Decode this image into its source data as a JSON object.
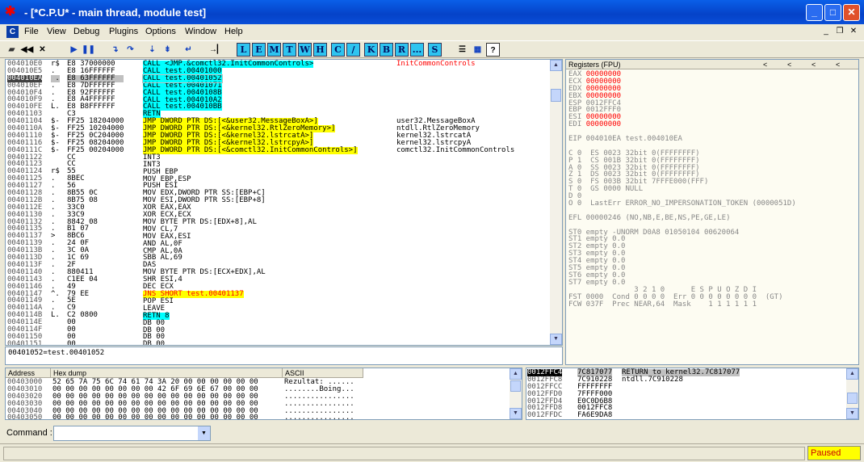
{
  "window": {
    "title": "- [*C.P.U* - main thread, module test]",
    "icon": "bug-icon",
    "controls": [
      "_",
      "□",
      "✕"
    ]
  },
  "menu": {
    "icon_letter": "C",
    "items": [
      "File",
      "View",
      "Debug",
      "Plugins",
      "Options",
      "Window",
      "Help"
    ]
  },
  "toolbar": {
    "letters": [
      "L",
      "E",
      "M",
      "T",
      "W",
      "H",
      "C",
      "/",
      "K",
      "B",
      "R",
      "...",
      "S"
    ]
  },
  "disasm": {
    "addresses": [
      "004010E0",
      "004010E5",
      "004010EA",
      "004010EF",
      "004010F4",
      "004010F9",
      "004010FE",
      "00401103",
      "00401104",
      "0040110A",
      "00401110",
      "00401116",
      "0040111C",
      "00401122",
      "00401123",
      "00401124",
      "00401125",
      "00401127",
      "00401128",
      "0040112B",
      "0040112E",
      "00401130",
      "00401132",
      "00401135",
      "00401137",
      "00401139",
      "0040113B",
      "0040113D",
      "0040113F",
      "00401140",
      "00401143",
      "00401146",
      "00401147",
      "00401149",
      "0040114A",
      "0040114B",
      "0040114E",
      "0040114F",
      "00401150",
      "00401151"
    ],
    "marks": [
      "r$",
      ".",
      " .",
      ". ",
      ". ",
      ". ",
      "L.",
      "  ",
      "$-",
      "$-",
      "$-",
      "$-",
      "$-",
      "  ",
      "  ",
      "r$",
      ". ",
      ". ",
      ". ",
      ". ",
      ". ",
      ". ",
      ". ",
      ". ",
      "> ",
      ". ",
      ". ",
      ". ",
      ". ",
      ". ",
      ". ",
      ". ",
      "^.",
      ". ",
      ". ",
      "L.",
      "  ",
      "  ",
      "  ",
      "  "
    ],
    "hex": [
      "E8 37000000",
      "E8 16FFFFFF",
      "E8 63FFFFFF",
      "E8 7DFFFFFF",
      "E8 92FFFFFF",
      "E8 A4FFFFFF",
      "E8 B8FFFFFF",
      "C3",
      "FF25 18204000",
      "FF25 10204000",
      "FF25 0C204000",
      "FF25 08204000",
      "FF25 00204000",
      "CC",
      "CC",
      "55",
      "8BEC",
      "56",
      "8B55 0C",
      "8B75 08",
      "33C0",
      "33C9",
      "8842 08",
      "B1 07",
      "8BC6",
      "24 0F",
      "3C 0A",
      "1C 69",
      "2F",
      "880411",
      "C1EE 04",
      "49",
      "79 EE",
      "5E",
      "C9",
      "C2 0800",
      "00",
      "00",
      "00",
      "00"
    ],
    "instr": [
      "CALL <JMP.&comctl32.InitCommonControls>",
      "CALL test.00401000",
      "CALL test.00401052",
      "CALL test.00401071",
      "CALL test.0040108B",
      "CALL test.004010A2",
      "CALL test.004010BB",
      "RETN",
      "JMP DWORD PTR DS:[<&user32.MessageBoxA>]",
      "JMP DWORD PTR DS:[<&kernel32.RtlZeroMemory>]",
      "JMP DWORD PTR DS:[<&kernel32.lstrcatA>]",
      "JMP DWORD PTR DS:[<&kernel32.lstrcpyA>]",
      "JMP DWORD PTR DS:[<&comctl32.InitCommonControls>]",
      "INT3",
      "INT3",
      "PUSH EBP",
      "MOV EBP,ESP",
      "PUSH ESI",
      "MOV EDX,DWORD PTR SS:[EBP+C]",
      "MOV ESI,DWORD PTR SS:[EBP+8]",
      "XOR EAX,EAX",
      "XOR ECX,ECX",
      "MOV BYTE PTR DS:[EDX+8],AL",
      "MOV CL,7",
      "MOV EAX,ESI",
      "AND AL,0F",
      "CMP AL,0A",
      "SBB AL,69",
      "DAS",
      "MOV BYTE PTR DS:[ECX+EDX],AL",
      "SHR ESI,4",
      "DEC ECX",
      "JNS SHORT test.00401137",
      "POP ESI",
      "LEAVE",
      "RETN 8",
      "DB 00",
      "DB 00",
      "DB 00",
      "DB 00"
    ],
    "comments": [
      "InitCommonControls",
      "",
      "",
      "",
      "",
      "",
      "",
      "",
      "user32.MessageBoxA",
      "ntdll.RtlZeroMemory",
      "kernel32.lstrcatA",
      "kernel32.lstrcpyA",
      "comctl32.InitCommonControls",
      "",
      "",
      "",
      "",
      "",
      "",
      "",
      "",
      "",
      "",
      "",
      "",
      "",
      "",
      "",
      "",
      "",
      "",
      "",
      "",
      "",
      "",
      "",
      "",
      "",
      "",
      ""
    ],
    "selected_row": 2,
    "info_line": "00401052=test.00401052"
  },
  "registers": {
    "header": "Registers (FPU)",
    "lines": [
      "EAX 00000000",
      "ECX 00000000",
      "EDX 00000000",
      "EBX 00000000",
      "ESP 0012FFC4",
      "EBP 0012FFF0",
      "ESI 00000000",
      "EDI 00000000",
      "",
      "EIP 004010EA test.004010EA",
      "",
      "C 0  ES 0023 32bit 0(FFFFFFFF)",
      "P 1  CS 001B 32bit 0(FFFFFFFF)",
      "A 0  SS 0023 32bit 0(FFFFFFFF)",
      "Z 1  DS 0023 32bit 0(FFFFFFFF)",
      "S 0  FS 003B 32bit 7FFFE000(FFF)",
      "T 0  GS 0000 NULL",
      "D 0",
      "O 0  LastErr ERROR_NO_IMPERSONATION_TOKEN (0000051D)",
      "",
      "EFL 00000246 (NO,NB,E,BE,NS,PE,GE,LE)",
      "",
      "ST0 empty -UNORM D0A8 01050104 00620064",
      "ST1 empty 0.0",
      "ST2 empty 0.0",
      "ST3 empty 0.0",
      "ST4 empty 0.0",
      "ST5 empty 0.0",
      "ST6 empty 0.0",
      "ST7 empty 0.0",
      "               3 2 1 0      E S P U O Z D I",
      "FST 0000  Cond 0 0 0 0  Err 0 0 0 0 0 0 0 0  (GT)",
      "FCW 037F  Prec NEAR,64  Mask    1 1 1 1 1 1"
    ]
  },
  "dump": {
    "headers": [
      "Address",
      "Hex dump",
      "ASCII"
    ],
    "addresses": [
      "00403000",
      "00403010",
      "00403020",
      "00403030",
      "00403040",
      "00403050"
    ],
    "hex": [
      "52 65 7A 75 6C 74 61 74 3A 20 00 00 00 00 00 00",
      "00 00 00 00 00 00 00 00 42 6F 69 6E 67 00 00 00",
      "00 00 00 00 00 00 00 00 00 00 00 00 00 00 00 00",
      "00 00 00 00 00 00 00 00 00 00 00 00 00 00 00 00",
      "00 00 00 00 00 00 00 00 00 00 00 00 00 00 00 00",
      "00 00 00 00 00 00 00 00 00 00 00 00 00 00 00 00"
    ],
    "ascii": [
      "Rezultat: ......",
      "........Boing...",
      "................",
      "................",
      "................",
      "................"
    ]
  },
  "stack": {
    "addresses": [
      "0012FFC4",
      "0012FFC8",
      "0012FFCC",
      "0012FFD0",
      "0012FFD4",
      "0012FFD8",
      "0012FFDC"
    ],
    "values": [
      "7C817077",
      "7C910228",
      "FFFFFFFF",
      "7FFFF000",
      "E0C0D6B8",
      "0012FFC8",
      "FA6E9DA8"
    ],
    "comments": [
      "RETURN to kernel32.7C817077",
      "ntdll.7C910228",
      "",
      "",
      "",
      "",
      ""
    ]
  },
  "command": {
    "label": "Command :",
    "value": ""
  },
  "status": {
    "left": "",
    "state": "Paused"
  },
  "colors": {
    "call_bg": "#00ffff",
    "jmp_bg": "#ffff00",
    "red_value": "#ff0000",
    "title_blue": "#0542c8"
  }
}
